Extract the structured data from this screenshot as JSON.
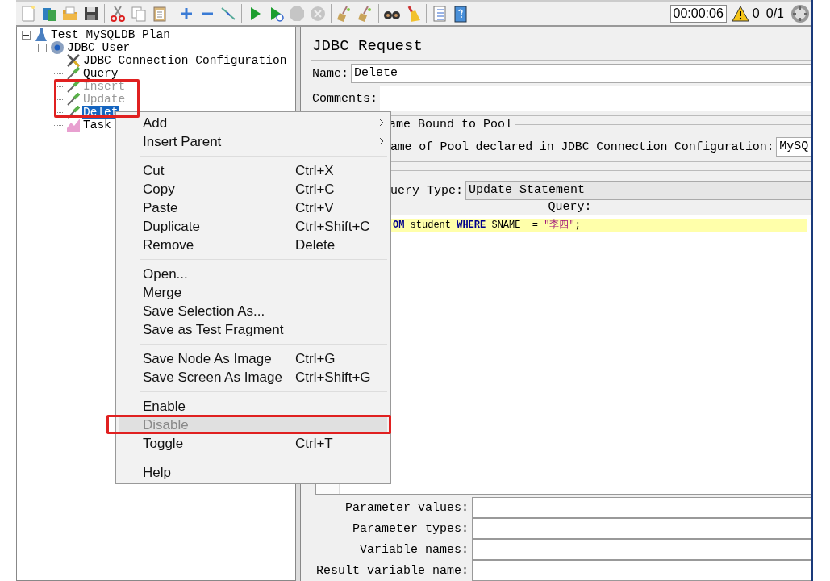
{
  "toolbar": {
    "groups": [
      [
        {
          "kind": "new",
          "disabled": false
        },
        {
          "kind": "templates",
          "disabled": false
        },
        {
          "kind": "open",
          "disabled": false
        },
        {
          "kind": "save",
          "disabled": false
        }
      ],
      [
        {
          "kind": "cut",
          "disabled": false
        },
        {
          "kind": "copy",
          "disabled": false
        },
        {
          "kind": "paste",
          "disabled": false
        }
      ],
      [
        {
          "kind": "expand",
          "disabled": false
        },
        {
          "kind": "collapse",
          "disabled": false
        },
        {
          "kind": "toggle",
          "disabled": false
        }
      ],
      [
        {
          "kind": "start",
          "disabled": false
        },
        {
          "kind": "startnopause",
          "disabled": false
        },
        {
          "kind": "stop",
          "disabled": true
        },
        {
          "kind": "shutdown",
          "disabled": true
        }
      ],
      [
        {
          "kind": "clear",
          "disabled": false
        },
        {
          "kind": "clearall",
          "disabled": false
        }
      ],
      [
        {
          "kind": "search",
          "disabled": false
        },
        {
          "kind": "reset",
          "disabled": false
        }
      ],
      [
        {
          "kind": "functions",
          "disabled": false
        },
        {
          "kind": "help",
          "disabled": false
        }
      ]
    ],
    "timer": "00:00:06",
    "warnings": "0",
    "threads": "0/1"
  },
  "tree": [
    {
      "label": "Test MySQLDB Plan",
      "kind": "plan",
      "expanded": true,
      "selected": false,
      "disabled": false,
      "children": [
        {
          "label": "JDBC User",
          "kind": "thread",
          "expanded": true,
          "selected": false,
          "disabled": false,
          "children": [
            {
              "label": "JDBC Connection Configuration",
              "kind": "config",
              "selected": false,
              "disabled": false
            },
            {
              "label": "Query",
              "kind": "sampler",
              "selected": false,
              "disabled": false
            },
            {
              "label": "Insert",
              "kind": "sampler",
              "selected": false,
              "disabled": true
            },
            {
              "label": "Update",
              "kind": "sampler",
              "selected": false,
              "disabled": true
            },
            {
              "label": "Delet",
              "kind": "sampler",
              "selected": true,
              "disabled": false
            },
            {
              "label": "Task",
              "kind": "listener",
              "selected": false,
              "disabled": false
            }
          ]
        }
      ]
    }
  ],
  "panel": {
    "title": "JDBC Request",
    "name_label": "Name:",
    "name_value": "Delete",
    "comments_label": "Comments:",
    "pool_legend": "ame Bound to Pool",
    "pool_label": "ame of Pool declared in JDBC Connection Configuration:",
    "pool_value": "MySQ",
    "query_type_label": "uery Type:",
    "query_type_value": "Update Statement",
    "query_label": "Query:",
    "query_line": [
      {
        "text": "OM",
        "kind": "keyword"
      },
      {
        "text": " student ",
        "kind": "plain"
      },
      {
        "text": "WHERE",
        "kind": "keyword"
      },
      {
        "text": " SNAME  = ",
        "kind": "plain"
      },
      {
        "text": "\"李四\"",
        "kind": "string"
      },
      {
        "text": ";",
        "kind": "plain"
      }
    ],
    "params": [
      {
        "label": "Parameter values:"
      },
      {
        "label": "Parameter types:"
      },
      {
        "label": "Variable names:"
      },
      {
        "label": "Result variable name:"
      }
    ]
  },
  "context_menu": {
    "groups": [
      [
        {
          "label": "Add",
          "submenu": true,
          "disabled": false,
          "highlighted": false
        },
        {
          "label": "Insert Parent",
          "submenu": true,
          "disabled": false,
          "highlighted": false
        }
      ],
      [
        {
          "label": "Cut",
          "shortcut": "Ctrl+X",
          "disabled": false,
          "highlighted": false
        },
        {
          "label": "Copy",
          "shortcut": "Ctrl+C",
          "disabled": false,
          "highlighted": false
        },
        {
          "label": "Paste",
          "shortcut": "Ctrl+V",
          "disabled": false,
          "highlighted": false
        },
        {
          "label": "Duplicate",
          "shortcut": "Ctrl+Shift+C",
          "disabled": false,
          "highlighted": false
        },
        {
          "label": "Remove",
          "shortcut": "Delete",
          "disabled": false,
          "highlighted": false
        }
      ],
      [
        {
          "label": "Open...",
          "disabled": false,
          "highlighted": false
        },
        {
          "label": "Merge",
          "disabled": false,
          "highlighted": false
        },
        {
          "label": "Save Selection As...",
          "disabled": false,
          "highlighted": false
        },
        {
          "label": "Save as Test Fragment",
          "disabled": false,
          "highlighted": false
        }
      ],
      [
        {
          "label": "Save Node As Image",
          "shortcut": "Ctrl+G",
          "disabled": false,
          "highlighted": false
        },
        {
          "label": "Save Screen As Image",
          "shortcut": "Ctrl+Shift+G",
          "disabled": false,
          "highlighted": false
        }
      ],
      [
        {
          "label": "Enable",
          "disabled": false,
          "highlighted": false
        },
        {
          "label": "Disable",
          "disabled": true,
          "highlighted": true
        },
        {
          "label": "Toggle",
          "shortcut": "Ctrl+T",
          "disabled": false,
          "highlighted": false
        }
      ],
      [
        {
          "label": "Help",
          "disabled": false,
          "highlighted": false
        }
      ]
    ]
  }
}
